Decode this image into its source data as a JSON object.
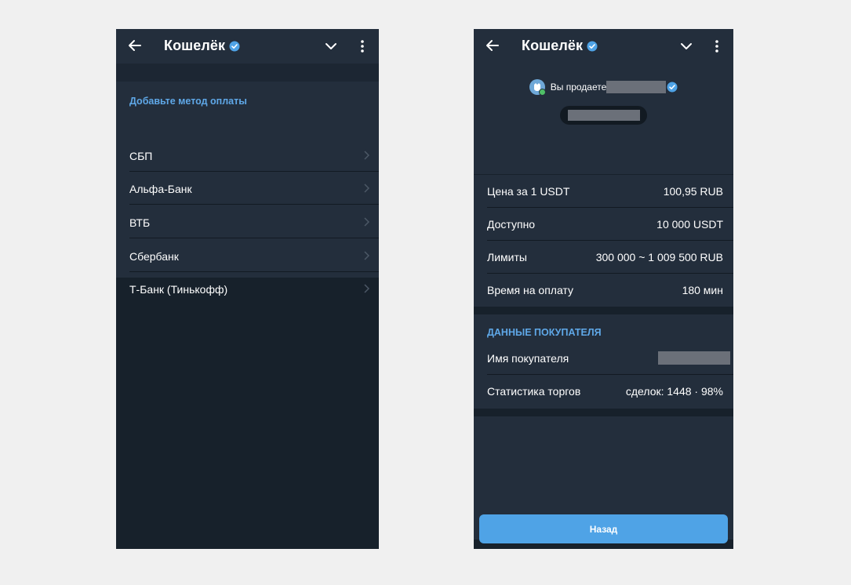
{
  "left": {
    "header": {
      "title": "Кошелёк"
    },
    "section_title": "Добавьте метод оплаты",
    "methods": [
      {
        "label": "СБП"
      },
      {
        "label": "Альфа-Банк"
      },
      {
        "label": "ВТБ"
      },
      {
        "label": "Сбербанк"
      },
      {
        "label": "Т-Банк (Тинькофф)"
      }
    ]
  },
  "right": {
    "header": {
      "title": "Кошелёк"
    },
    "seller": {
      "text": "Вы продаете"
    },
    "details": [
      {
        "label": "Цена за 1 USDT",
        "value": "100,95 RUB"
      },
      {
        "label": "Доступно",
        "value": "10 000 USDT"
      },
      {
        "label": "Лимиты",
        "value": "300 000 ~ 1 009 500 RUB"
      },
      {
        "label": "Время на оплату",
        "value": "180 мин"
      }
    ],
    "buyer_section_title": "ДАННЫЕ ПОКУПАТЕЛЯ",
    "buyer": {
      "name_label": "Имя покупателя",
      "stats_label": "Статистика торгов",
      "stats_value": "сделок: 1448 · 98%"
    },
    "back_button": "Назад"
  },
  "colors": {
    "background": "#f0f0f0",
    "app_bg": "#17212b",
    "panel": "#232e3c",
    "accent": "#4fa3e6",
    "section_title": "#5fa8e8",
    "online": "#4fbf67",
    "redaction": "#6b7079"
  },
  "icons": [
    "back-arrow-icon",
    "verified-badge-icon",
    "chevron-down-icon",
    "more-vertical-icon",
    "chevron-right-icon",
    "avatar-icon"
  ]
}
